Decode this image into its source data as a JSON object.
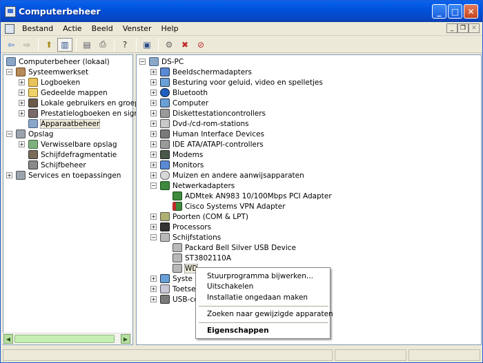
{
  "window": {
    "title": "Computerbeheer"
  },
  "menubar": {
    "items": [
      "Bestand",
      "Actie",
      "Beeld",
      "Venster",
      "Help"
    ]
  },
  "left_tree": {
    "root": "Computerbeheer (lokaal)",
    "systeemwerkset": "Systeemwerkset",
    "logboeken": "Logboeken",
    "gedeelde_mappen": "Gedeelde mappen",
    "lokale_gebruikers": "Lokale gebruikers en groepen",
    "prestatielogboeken": "Prestatielogboeken en signaleringen",
    "apparaatbeheer": "Apparaatbeheer",
    "opslag": "Opslag",
    "verwisselbare_opslag": "Verwisselbare opslag",
    "schijfdefragmentatie": "Schijfdefragmentatie",
    "schijfbeheer": "Schijfbeheer",
    "services": "Services en toepassingen"
  },
  "device_tree": {
    "root": "DS-PC",
    "beeldscherm": "Beeldschermadapters",
    "besturing": "Besturing voor geluid, video en spelletjes",
    "bluetooth": "Bluetooth",
    "computer": "Computer",
    "diskette": "Diskettestationcontrollers",
    "dvd": "Dvd-/cd-rom-stations",
    "hid": "Human Interface Devices",
    "ide": "IDE ATA/ATAPI-controllers",
    "modems": "Modems",
    "monitors": "Monitors",
    "muizen": "Muizen en andere aanwijsapparaten",
    "netwerk": "Netwerkadapters",
    "admtek": "ADMtek AN983 10/100Mbps PCI Adapter",
    "cisco": "Cisco Systems VPN Adapter",
    "poorten": "Poorten (COM & LPT)",
    "processors": "Processors",
    "schijfstations": "Schijfstations",
    "packard": "Packard Bell Silver USB Device",
    "st": "ST3802110A",
    "wd": "WD",
    "syste": "Syste",
    "toetse": "Toetse",
    "usb": "USB-co"
  },
  "context_menu": {
    "update": "Stuurprogramma bijwerken...",
    "disable": "Uitschakelen",
    "uninstall": "Installatie ongedaan maken",
    "scan": "Zoeken naar gewijzigde apparaten",
    "properties": "Eigenschappen"
  }
}
